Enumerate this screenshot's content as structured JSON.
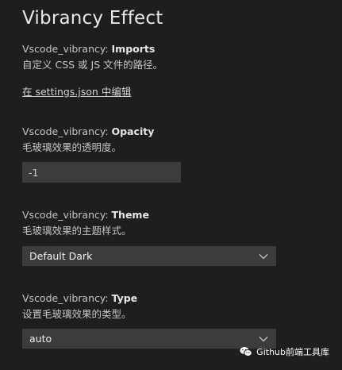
{
  "header": {
    "title": "Vibrancy Effect"
  },
  "settings": {
    "imports": {
      "prefix": "Vscode_vibrancy: ",
      "key": "Imports",
      "description": "自定义 CSS 或 JS 文件的路径。",
      "link_text": "在 settings.json 中编辑"
    },
    "opacity": {
      "prefix": "Vscode_vibrancy: ",
      "key": "Opacity",
      "description": "毛玻璃效果的透明度。",
      "value": "-1"
    },
    "theme": {
      "prefix": "Vscode_vibrancy: ",
      "key": "Theme",
      "description": "毛玻璃效果的主题样式。",
      "selected": "Default Dark"
    },
    "type": {
      "prefix": "Vscode_vibrancy: ",
      "key": "Type",
      "description": "设置毛玻璃效果的类型。",
      "selected": "auto"
    }
  },
  "watermark": {
    "text": "Github前端工具库",
    "icon": "wechat-icon"
  },
  "colors": {
    "background": "#1e1e1e",
    "input_background": "#3c3c3c",
    "text": "#cccccc"
  }
}
